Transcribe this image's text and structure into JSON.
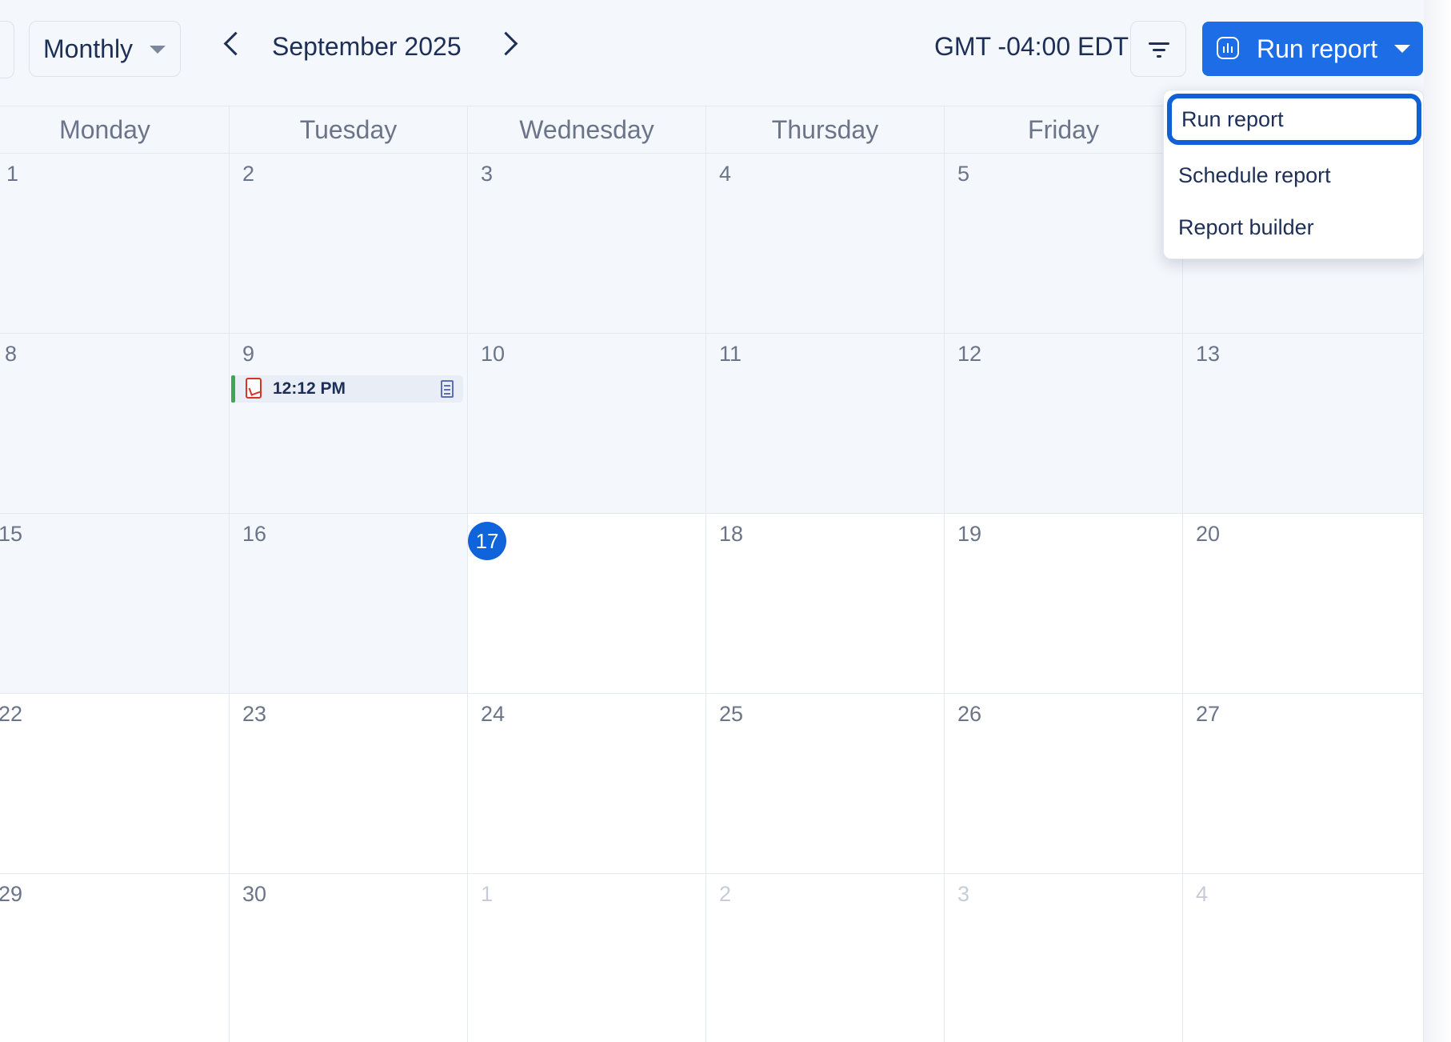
{
  "toolbar": {
    "view_select": "Monthly",
    "month_label": "September 2025",
    "timezone": "GMT -04:00 EDT",
    "run_report_label": "Run report"
  },
  "weekdays": [
    "Monday",
    "Tuesday",
    "Wednesday",
    "Thursday",
    "Friday"
  ],
  "weeks": [
    [
      "1",
      "2",
      "3",
      "4",
      "5",
      ""
    ],
    [
      "8",
      "9",
      "10",
      "11",
      "12",
      "13"
    ],
    [
      "15",
      "16",
      "17",
      "18",
      "19",
      "20"
    ],
    [
      "22",
      "23",
      "24",
      "25",
      "26",
      "27"
    ],
    [
      "29",
      "30",
      "1",
      "2",
      "3",
      "4"
    ]
  ],
  "event": {
    "time": "12:12 PM"
  },
  "menu": {
    "items": [
      "Run report",
      "Schedule report",
      "Report builder"
    ]
  },
  "colors": {
    "accent": "#1d6ee6",
    "today": "#0f63db",
    "event_bar": "#3fa84f",
    "pdf": "#d6332a"
  }
}
